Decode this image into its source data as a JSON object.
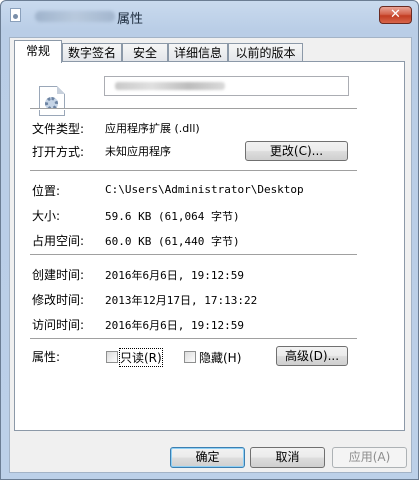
{
  "window": {
    "title": "属性",
    "close_label": "✕"
  },
  "tabs": [
    "常规",
    "数字签名",
    "安全",
    "详细信息",
    "以前的版本"
  ],
  "general": {
    "file_type_label": "文件类型:",
    "file_type_value": "应用程序扩展 (.dll)",
    "open_with_label": "打开方式:",
    "open_with_value": "未知应用程序",
    "change_button": "更改(C)...",
    "location_label": "位置:",
    "location_value": "C:\\Users\\Administrator\\Desktop",
    "size_label": "大小:",
    "size_value": "59.6 KB (61,064 字节)",
    "disk_size_label": "占用空间:",
    "disk_size_value": "60.0 KB (61,440 字节)",
    "created_label": "创建时间:",
    "created_value": "2016年6月6日, 19:12:59",
    "modified_label": "修改时间:",
    "modified_value": "2013年12月17日, 17:13:22",
    "accessed_label": "访问时间:",
    "accessed_value": "2016年6月6日, 19:12:59",
    "attributes_label": "属性:",
    "readonly_label": "只读(R)",
    "hidden_label": "隐藏(H)",
    "advanced_button": "高级(D)..."
  },
  "footer": {
    "ok": "确定",
    "cancel": "取消",
    "apply": "应用(A)"
  },
  "icons": [
    "dll-file-icon",
    "close-icon"
  ]
}
